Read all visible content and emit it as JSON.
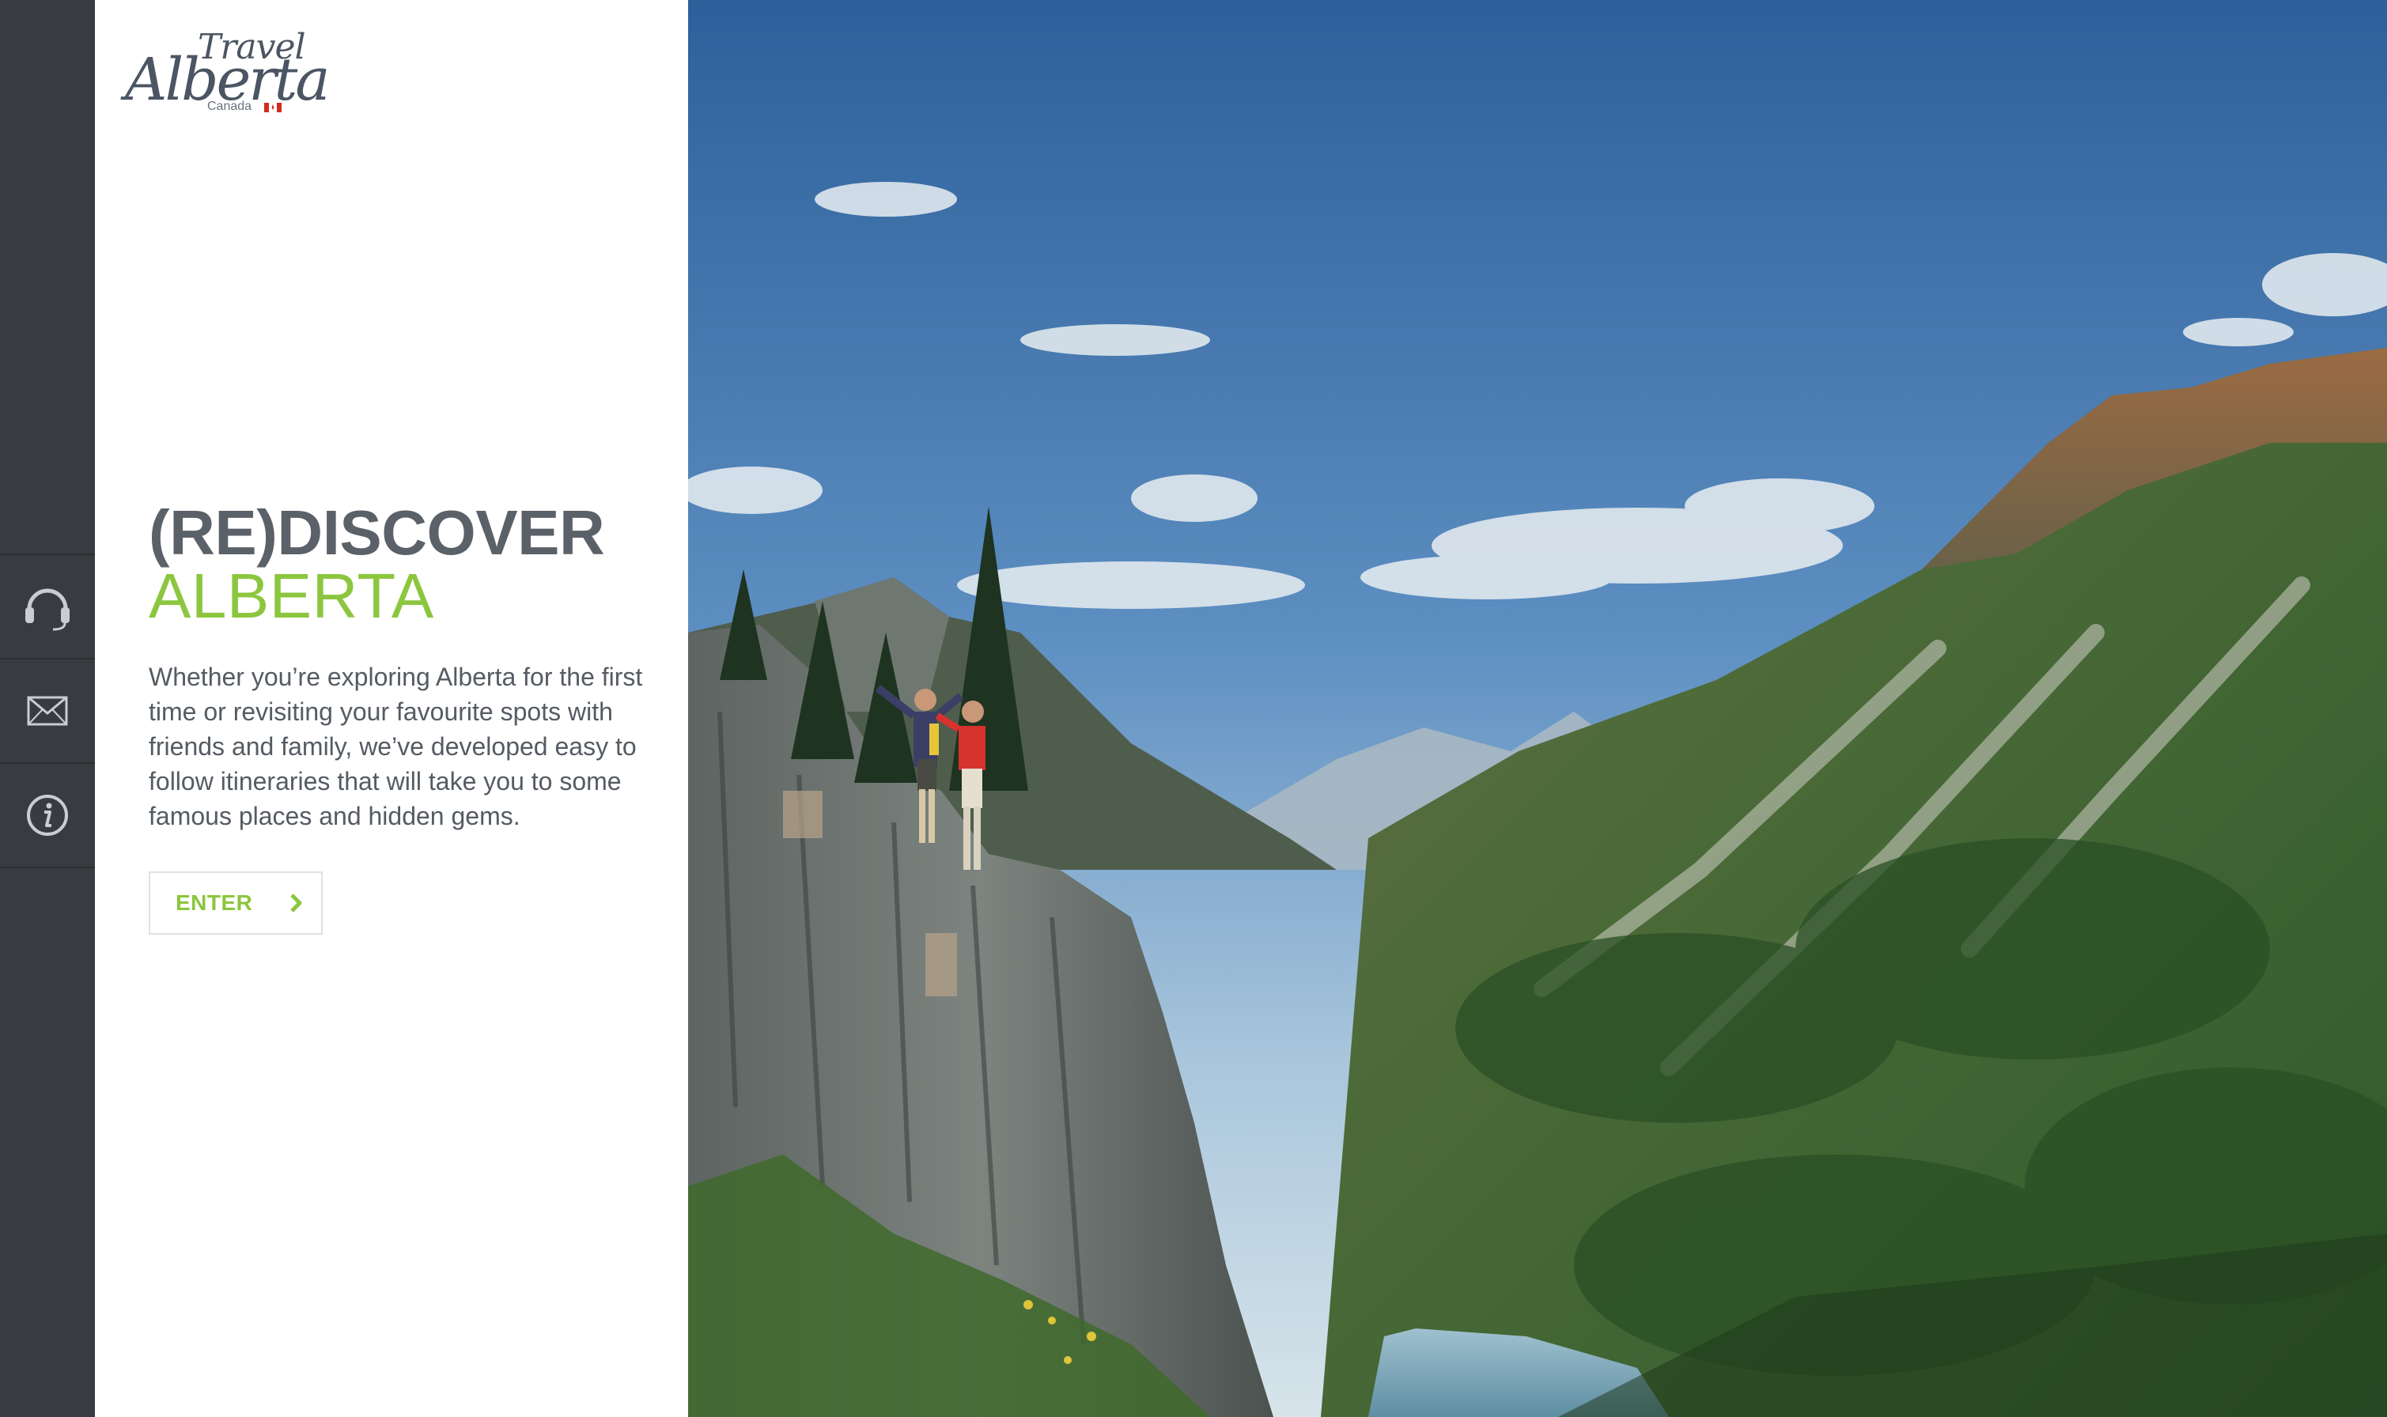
{
  "brand": {
    "logo_line1": "Travel",
    "logo_line2": "Alberta",
    "logo_country": "Canada",
    "green": "#8cc63f",
    "gray": "#5b6168"
  },
  "rail": {
    "items": [
      {
        "icon": "headset-icon"
      },
      {
        "icon": "envelope-icon"
      },
      {
        "icon": "info-icon"
      }
    ]
  },
  "hero": {
    "headline_line1": "(RE)DISCOVER",
    "headline_line2": "ALBERTA",
    "body": "Whether you’re exploring Alberta for the first time or revisiting your favourite spots with friends and family, we’ve developed easy to follow itineraries that will take you to some famous places and hidden gems.",
    "cta_label": "ENTER",
    "cta_icon": "chevron-right-icon",
    "photo_icon": "mountain-landscape-photo"
  }
}
